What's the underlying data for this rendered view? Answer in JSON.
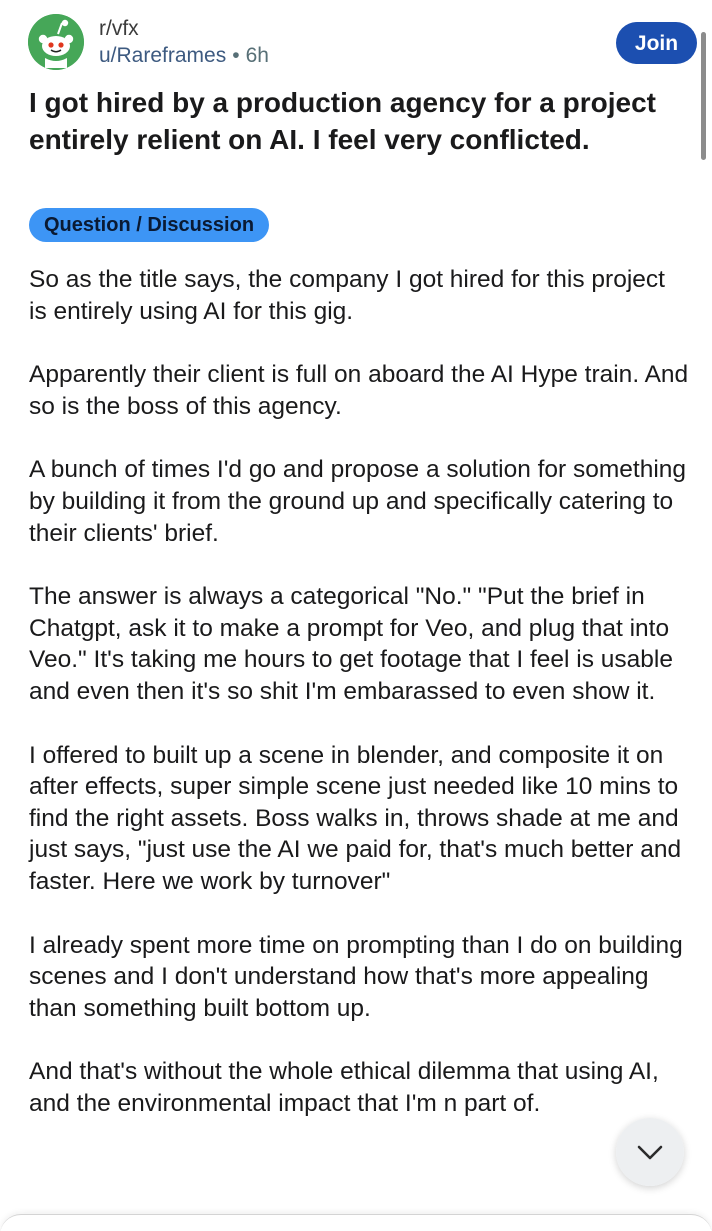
{
  "post": {
    "subreddit": "r/vfx",
    "author": "u/Rareframes",
    "separator": "•",
    "age": "6h",
    "join_label": "Join",
    "title": "I got hired by a production agency for a project entirely relient on AI. I feel very conflicted.",
    "flair": "Question / Discussion",
    "paragraphs": [
      "So as the title says, the company I got hired for this project is entirely using AI for this gig.",
      "Apparently their client is full on aboard the AI Hype train. And so is the boss of this agency.",
      "A bunch of times I'd go and propose a solution for something by building it from the ground up and specifically catering to their clients' brief.",
      "The answer is always a categorical \"No.\" \"Put the brief in Chatgpt, ask it to make a prompt for Veo, and plug that into Veo.\" It's taking me hours to get footage that I feel is usable and even then it's so shit I'm embarassed to even show it.",
      "I offered to built up a scene in blender, and composite it on after effects, super simple scene just needed like 10 mins to find the right assets. Boss walks in, throws shade at me and just says, \"just use the AI we paid for, that's much better and faster. Here we work by turnover\"",
      "I already spent more time on prompting than I do on building scenes and I don't understand how that's more appealing than something built bottom up.",
      "And that's without the whole ethical dilemma that using AI, and the environmental impact that I'm n part of."
    ]
  },
  "icons": {
    "avatar": "reddit-snoo-icon",
    "scroll": "chevron-down-icon"
  },
  "colors": {
    "join_button": "#1c4fb0",
    "flair_background": "#3d95f5",
    "avatar_background": "#46a758",
    "username": "#3d5a80"
  }
}
